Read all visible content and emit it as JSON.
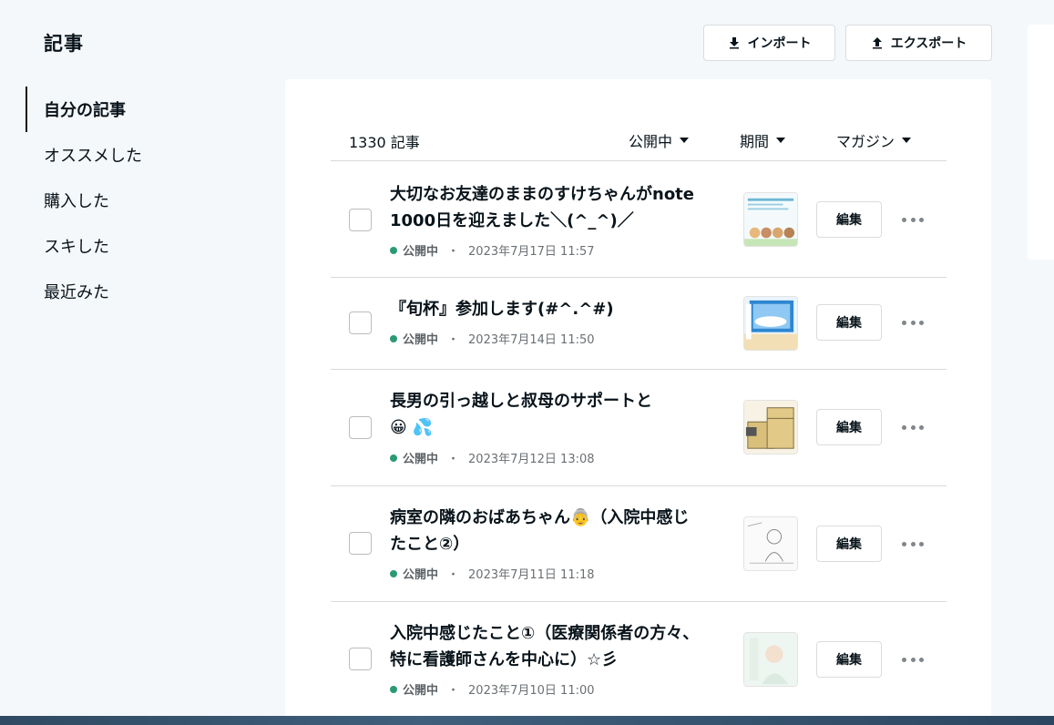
{
  "header": {
    "title": "記事",
    "import_label": "インポート",
    "export_label": "エクスポート"
  },
  "sidebar": {
    "items": [
      {
        "label": "自分の記事",
        "active": true
      },
      {
        "label": "オススメした"
      },
      {
        "label": "購入した"
      },
      {
        "label": "スキした"
      },
      {
        "label": "最近みた"
      }
    ]
  },
  "list": {
    "count": "1330 記事",
    "filters": {
      "status": "公開中",
      "period": "期間",
      "magazine": "マガジン"
    },
    "edit_label": "編集",
    "articles": [
      {
        "title": "大切なお友達のままのすけちゃんがnote1000日を迎えました＼(^_^)／",
        "status": "公開中",
        "sep": "・",
        "date": "2023年7月17日 11:57"
      },
      {
        "title": "『旬杯』参加します(#^.^#)",
        "status": "公開中",
        "sep": "・",
        "date": "2023年7月14日 11:50"
      },
      {
        "title": "長男の引っ越しと叔母のサポートと",
        "title_emoji": "😀 💦",
        "status": "公開中",
        "sep": "・",
        "date": "2023年7月12日 13:08"
      },
      {
        "title": "病室の隣のおばあちゃん👵（入院中感じたこと②）",
        "status": "公開中",
        "sep": "・",
        "date": "2023年7月11日 11:18"
      },
      {
        "title": "入院中感じたこと①（医療関係者の方々、特に看護師さんを中心に）☆彡",
        "status": "公開中",
        "sep": "・",
        "date": "2023年7月10日 11:00"
      }
    ]
  },
  "colors": {
    "status_dot": "#2b9a72",
    "background": "#f5f8fa"
  }
}
